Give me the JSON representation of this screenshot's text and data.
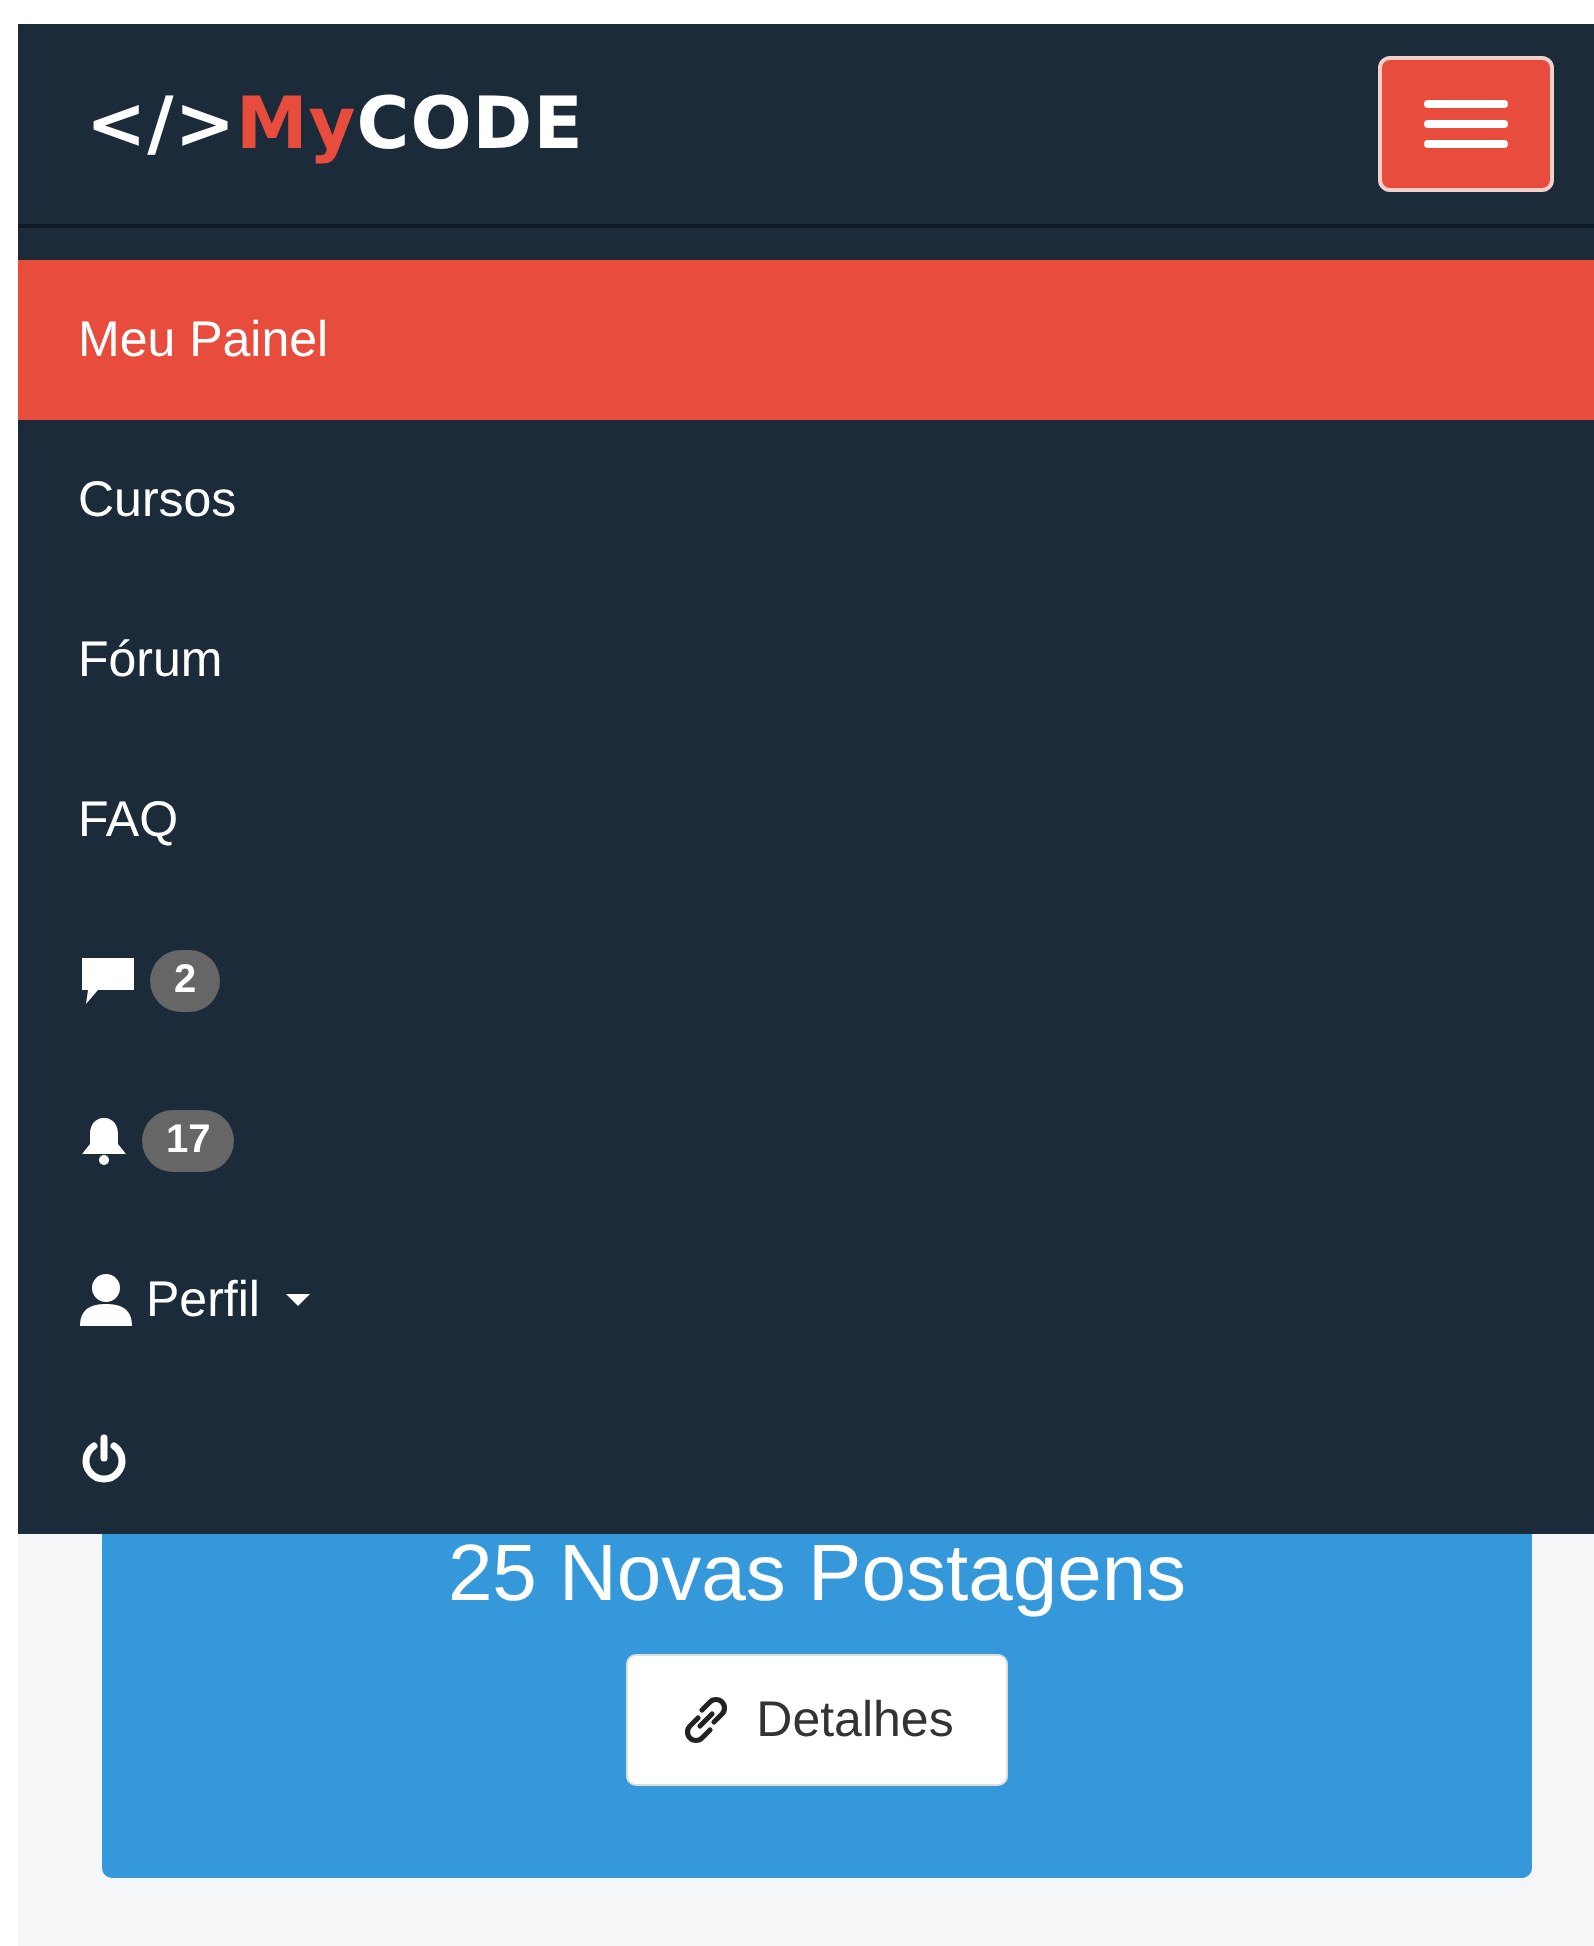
{
  "navbar": {
    "logo": {
      "prefix": "</>",
      "accent": "My",
      "name": "CODE"
    }
  },
  "menu": [
    {
      "kind": "link",
      "label": "Meu Painel",
      "selected": true
    },
    {
      "kind": "link",
      "label": "Cursos",
      "selected": false
    },
    {
      "kind": "link",
      "label": "Fórum",
      "selected": false
    },
    {
      "kind": "link",
      "label": "FAQ",
      "selected": false
    },
    {
      "kind": "messages",
      "badge": "2",
      "selected": false
    },
    {
      "kind": "notifications",
      "badge": "17",
      "selected": false
    },
    {
      "kind": "profile",
      "label": "Perfil",
      "selected": false
    },
    {
      "kind": "logout",
      "selected": false
    }
  ],
  "card": {
    "title": "25 Novas Postagens",
    "button": "Detalhes"
  }
}
